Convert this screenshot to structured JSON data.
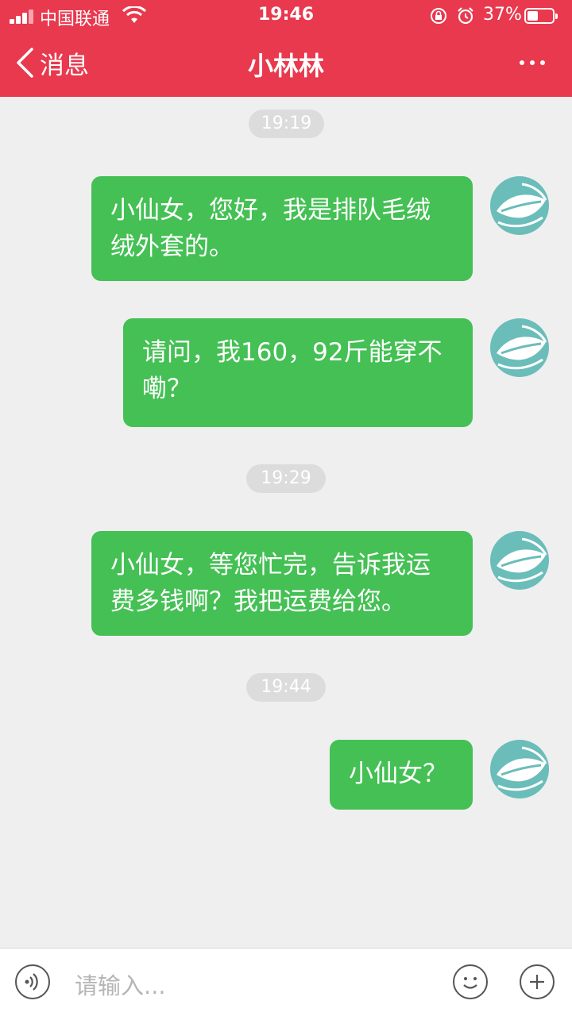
{
  "status_bar": {
    "carrier": "中国联通",
    "time": "19:46",
    "battery": "37%"
  },
  "nav": {
    "back_label": "消息",
    "title": "小林林"
  },
  "messages": [
    {
      "timestamp": "19:19"
    },
    {
      "text": "小仙女，您好，我是排队毛绒绒外套的。"
    },
    {
      "text": "请问，我160，92斤能穿不嘞？"
    },
    {
      "timestamp": "19:29"
    },
    {
      "text": "小仙女，等您忙完，告诉我运费多钱啊？我把运费给您。"
    },
    {
      "timestamp": "19:44"
    },
    {
      "text": "小仙女？"
    }
  ],
  "chat_lines": {
    "m1": [
      "小仙女，您好，我是排队毛绒",
      "绒外套的。"
    ],
    "m2": [
      "请问，我160，92斤能穿不",
      "嘞？"
    ],
    "m3": [
      "小仙女，等您忙完，告诉我运",
      "费多钱啊？我把运费给您。"
    ],
    "m4": [
      "小仙女？"
    ]
  },
  "input": {
    "placeholder": "请输入..."
  },
  "icons": {
    "back": "chevron-left-icon",
    "more": "more-dots-icon",
    "voice": "voice-icon",
    "emoji": "emoji-icon",
    "plus": "plus-icon"
  },
  "colors": {
    "header": "#e8394e",
    "bubble": "#44c054",
    "avatar": "#6bbdb9"
  }
}
